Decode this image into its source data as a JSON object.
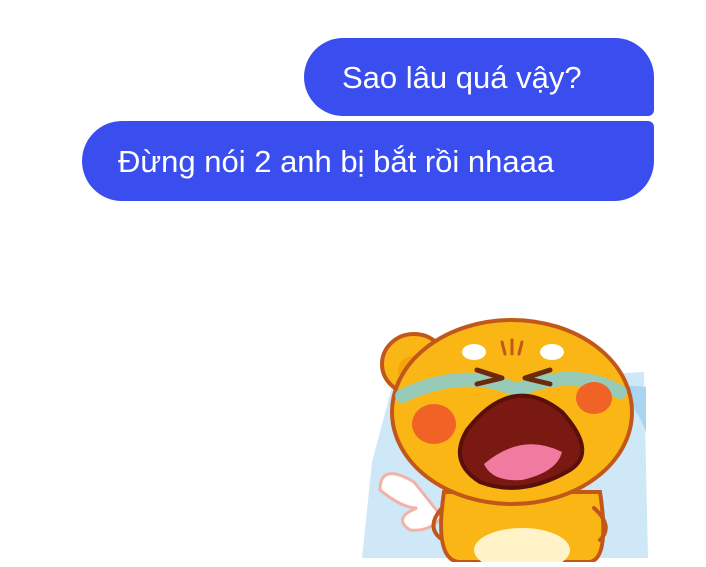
{
  "colors": {
    "bubble": "#3a4ef0",
    "bubble_text": "#ffffff",
    "background": "#ffffff"
  },
  "messages": [
    {
      "text": "Sao lâu quá vậy?"
    },
    {
      "text": "Đừng nói 2 anh bị bắt rồi nhaaa"
    }
  ],
  "sticker": {
    "icon": "crying-yellow-bear-sticker-icon"
  }
}
